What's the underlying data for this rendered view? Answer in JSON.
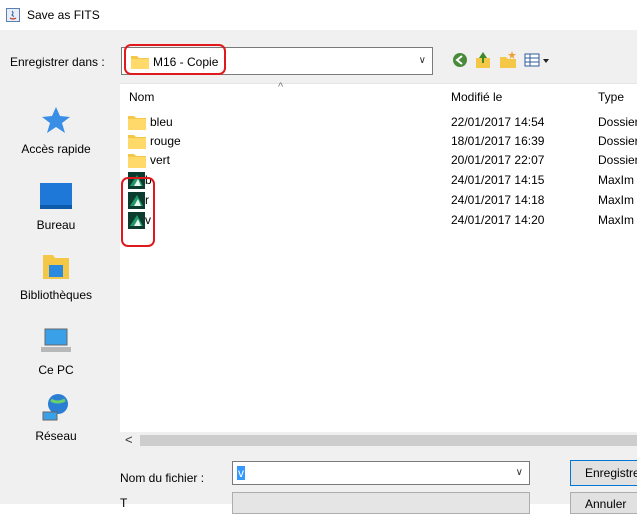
{
  "window": {
    "title": "Save as FITS"
  },
  "save_in": {
    "label": "Enregistrer dans :",
    "current_folder": "M16 - Copie"
  },
  "sidebar": {
    "items": [
      {
        "label": "Accès rapide",
        "icon": "quick-access-star-icon"
      },
      {
        "label": "Bureau",
        "icon": "desktop-icon"
      },
      {
        "label": "Bibliothèques",
        "icon": "libraries-icon"
      },
      {
        "label": "Ce PC",
        "icon": "computer-icon"
      },
      {
        "label": "Réseau",
        "icon": "network-icon"
      }
    ]
  },
  "columns": {
    "name": "Nom",
    "modified": "Modifié le",
    "type": "Type"
  },
  "files": [
    {
      "name": "bleu",
      "modified": "22/01/2017 14:54",
      "type": "Dossier",
      "kind": "folder"
    },
    {
      "name": "rouge",
      "modified": "18/01/2017 16:39",
      "type": "Dossier",
      "kind": "folder"
    },
    {
      "name": "vert",
      "modified": "20/01/2017 22:07",
      "type": "Dossier",
      "kind": "folder"
    },
    {
      "name": "b",
      "modified": "24/01/2017 14:15",
      "type": "MaxIm",
      "kind": "fits"
    },
    {
      "name": "r",
      "modified": "24/01/2017 14:18",
      "type": "MaxIm",
      "kind": "fits"
    },
    {
      "name": "v",
      "modified": "24/01/2017 14:20",
      "type": "MaxIm",
      "kind": "fits"
    }
  ],
  "filename": {
    "label": "Nom du fichier :",
    "value": "v"
  },
  "filetype": {
    "label": "T"
  },
  "buttons": {
    "save": "Enregistrer",
    "cancel": "Annuler"
  },
  "colors": {
    "highlight_ring": "#e0191d",
    "folder": "#f5c747",
    "selection": "#3399ff"
  }
}
